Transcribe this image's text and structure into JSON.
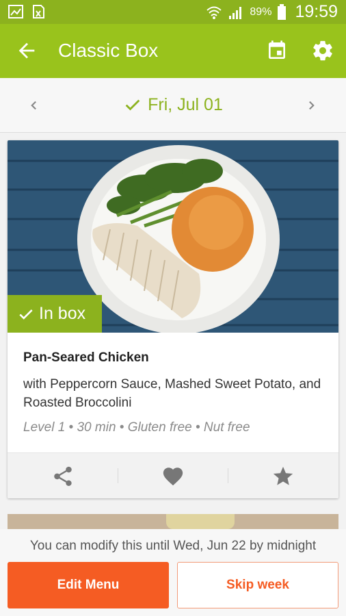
{
  "status_bar": {
    "battery_percent": "89%",
    "time": "19:59",
    "icons": [
      "gallery-icon",
      "excel-icon",
      "wifi-icon",
      "signal-icon",
      "battery-icon"
    ]
  },
  "app_bar": {
    "title": "Classic Box",
    "icons": [
      "back-arrow-icon",
      "calendar-icon",
      "gear-icon"
    ]
  },
  "date_nav": {
    "date": "Fri, Jul 01",
    "confirmed": true
  },
  "recipe": {
    "badge": "In box",
    "name": "Pan-Seared Chicken",
    "subtitle": "with Peppercorn Sauce, Mashed Sweet Potato, and Roasted Broccolini",
    "meta": "Level 1 • 30 min • Gluten free • Nut free",
    "actions": [
      "share-icon",
      "heart-icon",
      "star-icon"
    ]
  },
  "footer": {
    "notice": "You can modify this until Wed, Jun 22 by midnight",
    "edit_label": "Edit Menu",
    "skip_label": "Skip week"
  },
  "colors": {
    "status_green": "#8cb21e",
    "app_bar_green": "#99c31c",
    "accent_orange": "#f55c23"
  }
}
